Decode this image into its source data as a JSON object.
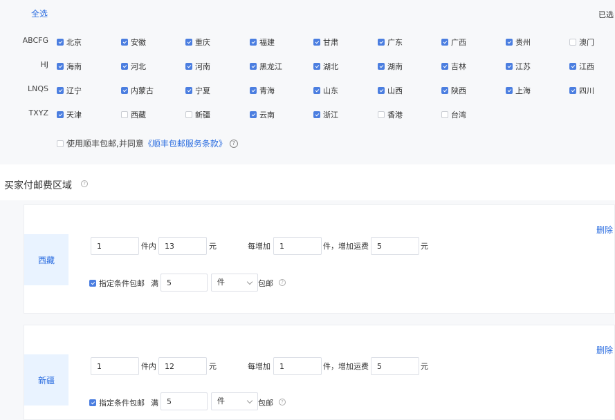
{
  "header": {
    "select_all": "全选",
    "selected_label": "已选"
  },
  "groups": [
    {
      "label": "ABCFG",
      "provinces": [
        {
          "name": "北京",
          "checked": true
        },
        {
          "name": "安徽",
          "checked": true
        },
        {
          "name": "重庆",
          "checked": true
        },
        {
          "name": "福建",
          "checked": true
        },
        {
          "name": "甘肃",
          "checked": true
        },
        {
          "name": "广东",
          "checked": true
        },
        {
          "name": "广西",
          "checked": true
        },
        {
          "name": "贵州",
          "checked": true
        },
        {
          "name": "澳门",
          "checked": false
        }
      ]
    },
    {
      "label": "HJ",
      "provinces": [
        {
          "name": "海南",
          "checked": true
        },
        {
          "name": "河北",
          "checked": true
        },
        {
          "name": "河南",
          "checked": true
        },
        {
          "name": "黑龙江",
          "checked": true
        },
        {
          "name": "湖北",
          "checked": true
        },
        {
          "name": "湖南",
          "checked": true
        },
        {
          "name": "吉林",
          "checked": true
        },
        {
          "name": "江苏",
          "checked": true
        },
        {
          "name": "江西",
          "checked": true
        }
      ]
    },
    {
      "label": "LNQS",
      "provinces": [
        {
          "name": "辽宁",
          "checked": true
        },
        {
          "name": "内蒙古",
          "checked": true
        },
        {
          "name": "宁夏",
          "checked": true
        },
        {
          "name": "青海",
          "checked": true
        },
        {
          "name": "山东",
          "checked": true
        },
        {
          "name": "山西",
          "checked": true
        },
        {
          "name": "陕西",
          "checked": true
        },
        {
          "name": "上海",
          "checked": true
        },
        {
          "name": "四川",
          "checked": true
        }
      ]
    },
    {
      "label": "TXYZ",
      "provinces": [
        {
          "name": "天津",
          "checked": true
        },
        {
          "name": "西藏",
          "checked": false
        },
        {
          "name": "新疆",
          "checked": false
        },
        {
          "name": "云南",
          "checked": true
        },
        {
          "name": "浙江",
          "checked": true
        },
        {
          "name": "香港",
          "checked": false
        },
        {
          "name": "台湾",
          "checked": false
        }
      ]
    }
  ],
  "agreement": {
    "checked": false,
    "text": "使用顺丰包邮,并同意",
    "link": "《顺丰包邮服务条款》"
  },
  "paid_section": {
    "title": "买家付邮费区域"
  },
  "labels": {
    "pieces_within": "件内",
    "yuan": "元",
    "each_add": "每增加",
    "pieces_add_fee": "件，增加运费",
    "conditional_free": "指定条件包邮",
    "full": "满",
    "free_shipping": "包邮",
    "delete": "删除"
  },
  "regions": [
    {
      "name": "西藏",
      "first_qty": "1",
      "first_fee": "13",
      "add_qty": "1",
      "add_fee": "5",
      "cond_checked": true,
      "cond_value": "5",
      "cond_unit": "件"
    },
    {
      "name": "新疆",
      "first_qty": "1",
      "first_fee": "12",
      "add_qty": "1",
      "add_fee": "5",
      "cond_checked": true,
      "cond_value": "5",
      "cond_unit": "件"
    }
  ],
  "icons": {
    "help": "question-circle-icon",
    "checkbox_checked": "check-icon",
    "select": "chevron-down-icon"
  },
  "colors": {
    "accent": "#2b6de0",
    "checkbox": "#4b7ee0",
    "region_bg": "#e9f3ff",
    "panel_bg": "#f7f8fa"
  }
}
